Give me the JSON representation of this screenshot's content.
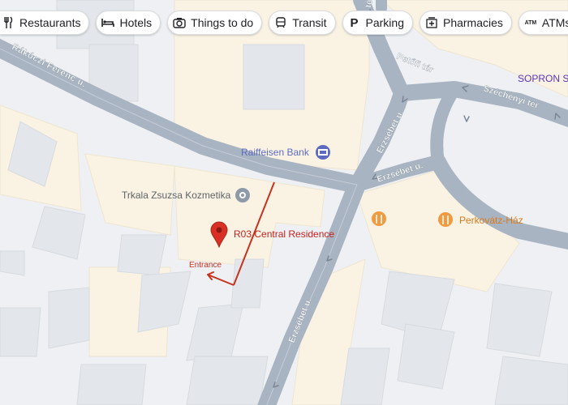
{
  "chips": [
    {
      "label": "Restaurants",
      "icon": "fork-knife-icon"
    },
    {
      "label": "Hotels",
      "icon": "bed-icon"
    },
    {
      "label": "Things to do",
      "icon": "camera-icon"
    },
    {
      "label": "Transit",
      "icon": "train-icon"
    },
    {
      "label": "Parking",
      "icon": "parking-icon"
    },
    {
      "label": "Pharmacies",
      "icon": "pharmacy-icon"
    },
    {
      "label": "ATMs",
      "icon": "atm-icon"
    }
  ],
  "streets": {
    "rakoczi": "Rákóczi Ferenc u.",
    "petofi": "Petőfi tér",
    "szechenyi": "Széchenyi tér",
    "erzsebet_north": "Erzsébet u.",
    "erzsebet_east": "Erzsébet u.",
    "erzsebet_south": "Erzsébet u.",
    "top_tez": "tér"
  },
  "places": {
    "raiffeisen": "Raiffeisen Bank",
    "trkala": "Trkala Zsuzsa Kozmetika",
    "perkovatz": "Perkovátz-Ház",
    "sopron": "SOPRON Sir",
    "pin_label": "R03 Central Residence",
    "entrance": "Entrance"
  },
  "colors": {
    "road": "#a9b4c2",
    "building": "#faf3e4",
    "pin": "#d93025",
    "annotation": "#c5331f",
    "poi_orange": "#f29a3f",
    "bank_blue": "#5c6bc0",
    "purple_text": "#5e35b1"
  }
}
